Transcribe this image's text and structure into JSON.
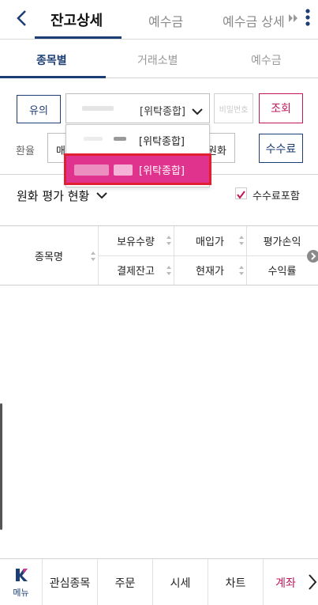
{
  "header": {
    "tabs": [
      {
        "label": "잔고상세",
        "active": true
      },
      {
        "label": "예수금",
        "active": false
      },
      {
        "label": "예수금 상세",
        "active": false
      }
    ]
  },
  "subtabs": [
    {
      "label": "종목별",
      "active": true
    },
    {
      "label": "거래소별",
      "active": false
    },
    {
      "label": "예수금",
      "active": false
    }
  ],
  "account_row": {
    "caution_label": "유의",
    "selected_account_type": "[위탁종합]",
    "password_placeholder": "비밀번호",
    "inquiry_label": "조회"
  },
  "dropdown": {
    "options": [
      {
        "label": "[위탁종합]",
        "selected": false
      },
      {
        "label": "[위탁종합]",
        "selected": true
      }
    ]
  },
  "exchange_row": {
    "label": "환율",
    "field_prefix": "매",
    "field_suffix": "원화",
    "fee_button": "수수료"
  },
  "valuation": {
    "title": "원화 평가 현황",
    "checkbox_label": "수수료포함",
    "checkbox_checked": true
  },
  "table_header": {
    "stock_name": "종목명",
    "row1": [
      "보유수량",
      "매입가",
      "평가손익"
    ],
    "row2": [
      "결제잔고",
      "현재가",
      "수익률"
    ]
  },
  "bottom_nav": {
    "menu_label": "메뉴",
    "items": [
      "관심종목",
      "주문",
      "시세",
      "차트",
      "계좌"
    ],
    "active_item": "계좌"
  },
  "colors": {
    "navy": "#1c3e74",
    "pink": "#c2185b",
    "highlight": "#e0338e",
    "highlight_border": "#e02030"
  }
}
